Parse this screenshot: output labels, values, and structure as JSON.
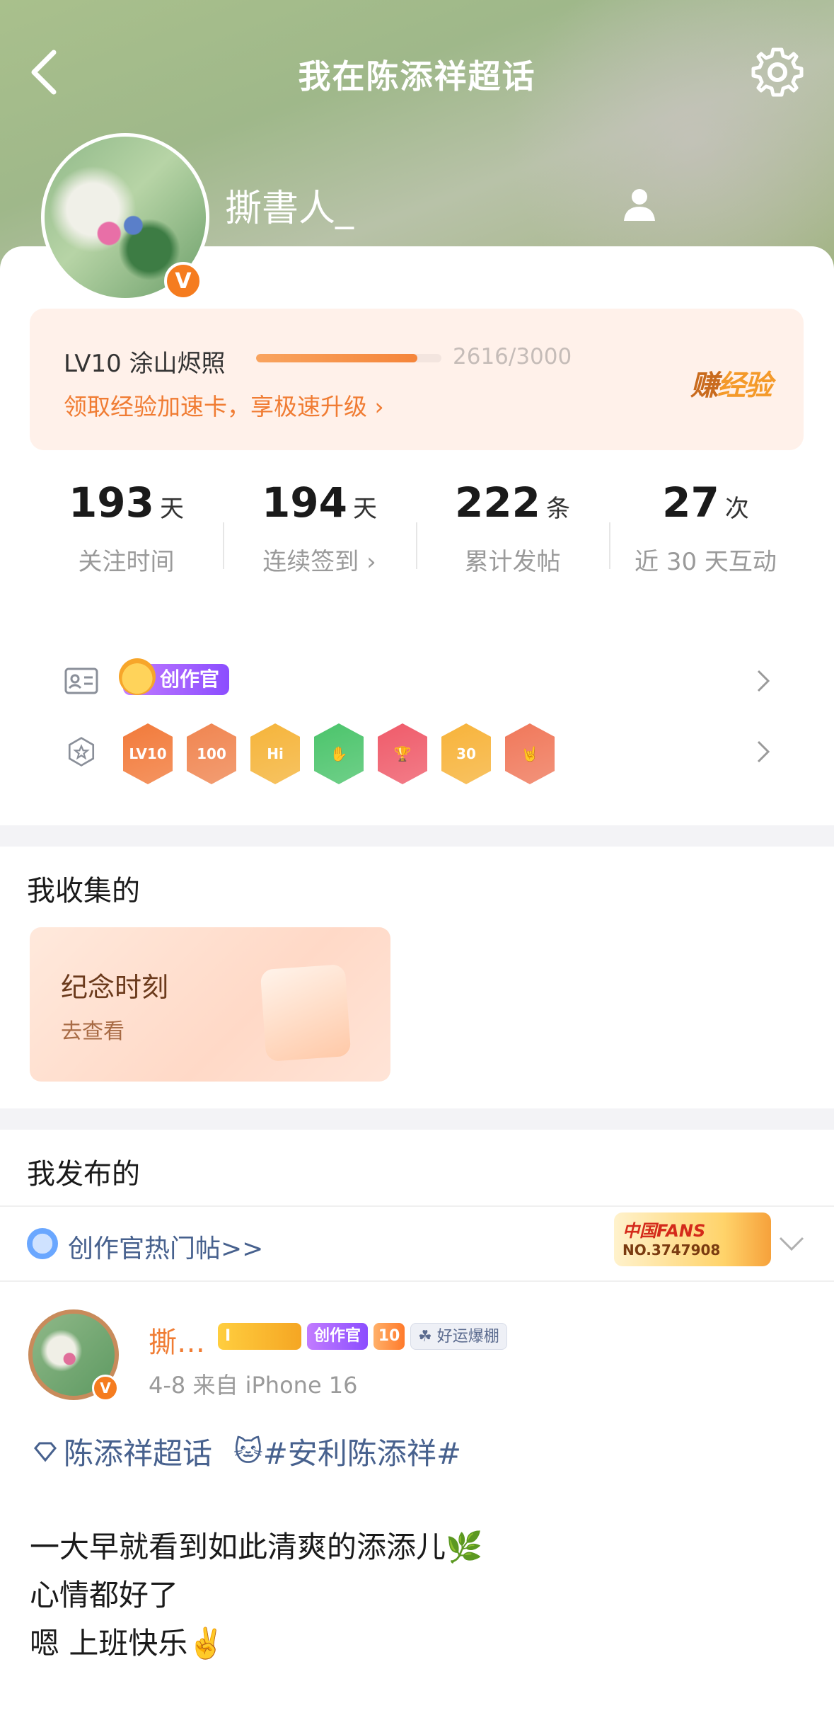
{
  "nav": {
    "title": "我在陈添祥超话"
  },
  "profile": {
    "username": "撕書人_",
    "verified_mark": "V"
  },
  "level": {
    "name": "LV10 涂山烬照",
    "progress_text": "2616/3000",
    "progress_fraction": 0.872,
    "boost_link": "领取经验加速卡，享极速升级 ›",
    "earn_xp_part1": "赚",
    "earn_xp_part2": "经验"
  },
  "stats": [
    {
      "value": "193",
      "unit": "天",
      "label": "关注时间"
    },
    {
      "value": "194",
      "unit": "天",
      "label": "连续签到 ›"
    },
    {
      "value": "222",
      "unit": "条",
      "label": "累计发帖"
    },
    {
      "value": "27",
      "unit": "次",
      "label": "近 30 天互动"
    }
  ],
  "badges": {
    "creator_label": "创作官",
    "medals": [
      {
        "icon": "lv10-medal-icon",
        "text": "LV10",
        "color": "#f27a3a"
      },
      {
        "icon": "100-days-medal-icon",
        "text": "100",
        "color": "#f08550"
      },
      {
        "icon": "hi-medal-icon",
        "text": "Hi",
        "color": "#f5b43a"
      },
      {
        "icon": "hand-medal-icon",
        "text": "✋",
        "color": "#4bc46b"
      },
      {
        "icon": "trophy-medal-icon",
        "text": "🏆",
        "color": "#ef5b6a"
      },
      {
        "icon": "30-days-medal-icon",
        "text": "30",
        "color": "#f7b33a"
      },
      {
        "icon": "rock-hand-medal-icon",
        "text": "🤘",
        "color": "#f0785a"
      }
    ]
  },
  "collected": {
    "title": "我收集的",
    "card_title": "纪念时刻",
    "card_sub": "去查看"
  },
  "published": {
    "title": "我发布的",
    "hot_link": "创作官热门帖>>",
    "fans_badge_top": "中国FANS",
    "fans_badge_no": "NO.3747908"
  },
  "post": {
    "author": "撕…",
    "badge_i": "I",
    "badge_creator": "创作官",
    "badge_lv": "10",
    "badge_luck": "好运爆棚",
    "meta": "4-8  来自 iPhone 16",
    "tag_topic": "陈添祥超话",
    "tag_hashtag": "#安利陈添祥#",
    "line1": "一大早就看到如此清爽的添添儿🌿",
    "line2": "心情都好了",
    "line3": "嗯 上班快乐✌️"
  }
}
